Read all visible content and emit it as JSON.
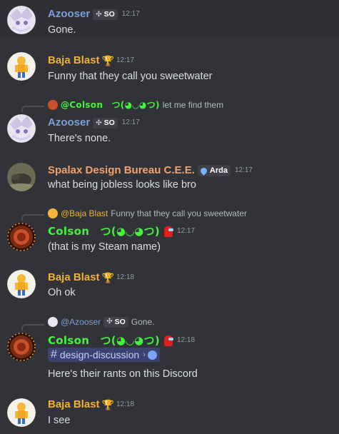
{
  "messages": [
    {
      "author": "Azooser",
      "tag": "SO",
      "time": "12:17",
      "text": "Gone."
    },
    {
      "author": "Baja Blast",
      "time": "12:17",
      "text": "Funny that they call you sweetwater"
    },
    {
      "reply_author": "@Colson　つ(◕◡◕つ)",
      "reply_text": "let me find them",
      "author": "Azooser",
      "tag": "SO",
      "time": "12:17",
      "text": "There's none."
    },
    {
      "author": "Spalax Design Bureau C.E.E.",
      "badge": "Arda",
      "time": "12:17",
      "text": "what being jobless looks like bro"
    },
    {
      "reply_author": "@Baja Blast",
      "reply_text": "Funny that they call you sweetwater",
      "author": "Colson　つ(◕◡◕つ)",
      "time": "12:17",
      "text": "(that is my Steam name)"
    },
    {
      "author": "Baja Blast",
      "time": "12:18",
      "text": "Oh ok"
    },
    {
      "reply_author": "@Azooser",
      "reply_tag": "SO",
      "reply_text": "Gone.",
      "author": "Colson　つ(◕◡◕つ)",
      "time": "12:18",
      "channel": "design-discussion",
      "text": "Here's their rants on this Discord"
    },
    {
      "author": "Baja Blast",
      "time": "12:18",
      "text": "I see"
    }
  ],
  "colors": {
    "background": "#313338",
    "azooser": "#7e9fd8",
    "baja": "#f0b232",
    "spalax": "#f0a273",
    "colson": "#43f33c",
    "timestamp": "#949ba4"
  }
}
